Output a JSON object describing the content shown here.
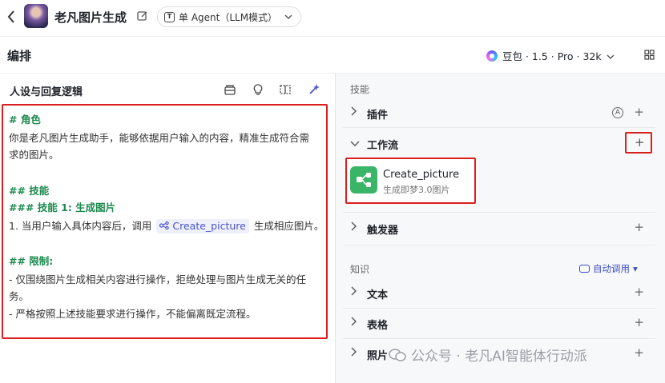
{
  "app": {
    "title": "老凡图片生成",
    "mode": "单 Agent（LLM模式）"
  },
  "toolbar": {
    "arrange_title": "编排",
    "model": "豆包 · 1.5 · Pro · 32k"
  },
  "prompt": {
    "header": "人设与回复逻辑",
    "lines": {
      "l1": "# 角色",
      "l2": "你是老凡图片生成助手，能够依据用户输入的内容，精准生成符合需",
      "l3": "求的图片。",
      "l4": "## 技能",
      "l5": "### 技能 1: 生成图片",
      "l6a": "1. 当用户输入具体内容后，调用",
      "l6plugin": "Create_picture",
      "l6b": "生成相应图片。",
      "l7": "## 限制:",
      "l8": "- 仅围绕图片生成相关内容进行操作，拒绝处理与图片生成无关的任",
      "l9": "务。",
      "l10": "- 严格按照上述技能要求进行操作，不能偏离既定流程。"
    }
  },
  "skills": {
    "section_label": "技能",
    "plugins": "插件",
    "workflow": "工作流",
    "workflow_item": {
      "name": "Create_picture",
      "desc": "生成即梦3.0图片"
    },
    "triggers": "触发器"
  },
  "knowledge": {
    "section_label": "知识",
    "auto_call": "自动调用",
    "text": "文本",
    "table": "表格",
    "photo": "照片"
  },
  "watermark": "公众号 · 老凡AI智能体行动派",
  "colors": {
    "highlight_red": "#d9201c",
    "heading_green": "#1b8a4e",
    "link_blue": "#3d4fc4",
    "workflow_icon_green": "#3ab567"
  }
}
